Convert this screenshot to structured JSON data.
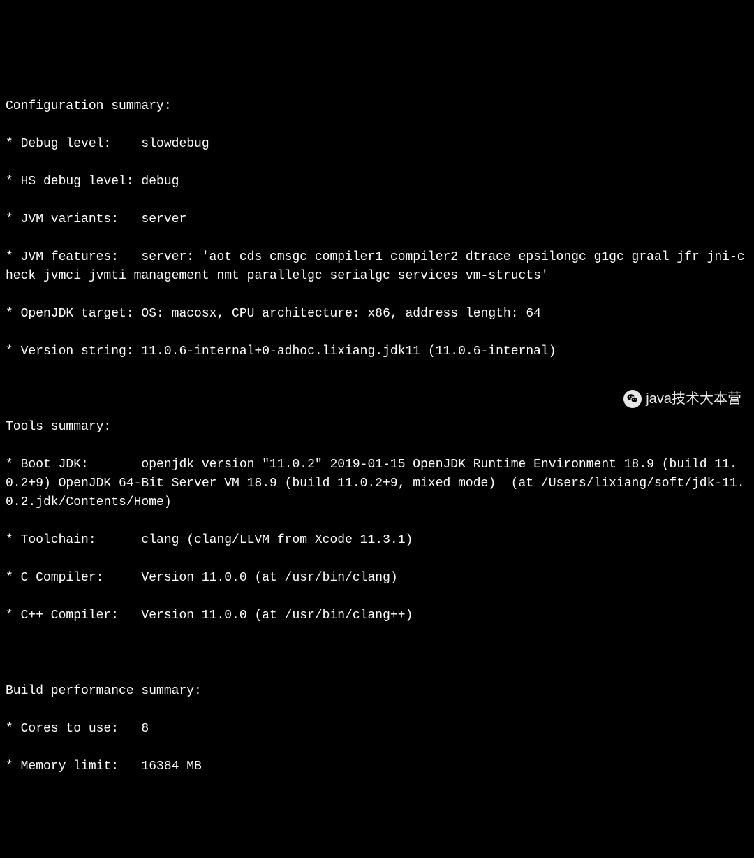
{
  "terminal": {
    "sections": {
      "configuration": {
        "header": "Configuration summary:",
        "debug_level": "* Debug level:    slowdebug",
        "hs_debug_level": "* HS debug level: debug",
        "jvm_variants": "* JVM variants:   server",
        "jvm_features": "* JVM features:   server: 'aot cds cmsgc compiler1 compiler2 dtrace epsilongc g1gc graal jfr jni-check jvmci jvmti management nmt parallelgc serialgc services vm-structs'",
        "openjdk_target": "* OpenJDK target: OS: macosx, CPU architecture: x86, address length: 64",
        "version_string": "* Version string: 11.0.6-internal+0-adhoc.lixiang.jdk11 (11.0.6-internal)"
      },
      "tools": {
        "header": "Tools summary:",
        "boot_jdk": "* Boot JDK:       openjdk version \"11.0.2\" 2019-01-15 OpenJDK Runtime Environment 18.9 (build 11.0.2+9) OpenJDK 64-Bit Server VM 18.9 (build 11.0.2+9, mixed mode)  (at /Users/lixiang/soft/jdk-11.0.2.jdk/Contents/Home)",
        "toolchain": "* Toolchain:      clang (clang/LLVM from Xcode 11.3.1)",
        "c_compiler": "* C Compiler:     Version 11.0.0 (at /usr/bin/clang)",
        "cpp_compiler": "* C++ Compiler:   Version 11.0.0 (at /usr/bin/clang++)"
      },
      "build_performance": {
        "header": "Build performance summary:",
        "cores": "* Cores to use:   8",
        "memory_limit": "* Memory limit:   16384 MB"
      }
    }
  },
  "watermark": {
    "text": "java技术大本营"
  }
}
